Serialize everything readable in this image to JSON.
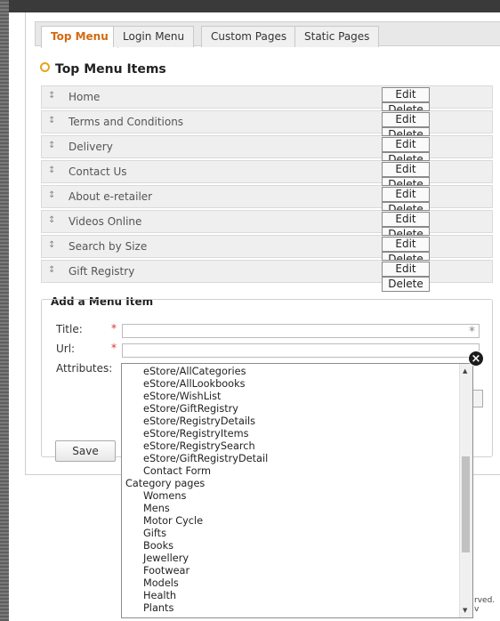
{
  "tabs": [
    {
      "label": "Top Menu",
      "active": true
    },
    {
      "label": "Login Menu",
      "active": false
    },
    {
      "label": "Custom Pages",
      "active": false
    },
    {
      "label": "Static Pages",
      "active": false
    }
  ],
  "section_title": "Top Menu Items",
  "menu_items": [
    {
      "label": "Home"
    },
    {
      "label": "Terms and Conditions"
    },
    {
      "label": "Delivery"
    },
    {
      "label": "Contact Us"
    },
    {
      "label": "About e-retailer"
    },
    {
      "label": "Videos Online"
    },
    {
      "label": "Search by Size"
    },
    {
      "label": "Gift Registry"
    }
  ],
  "row_buttons": {
    "edit": "Edit",
    "delete": "Delete",
    "grip": "↕"
  },
  "add_form": {
    "legend": "Add a Menu Item",
    "title_label": "Title:",
    "url_label": "Url:",
    "attributes_label": "Attributes:",
    "required_mark": "*",
    "save_label": "Save"
  },
  "dropdown_options": [
    {
      "text": "eStore/AllCategories",
      "indent": true
    },
    {
      "text": "eStore/AllLookbooks",
      "indent": true
    },
    {
      "text": "eStore/WishList",
      "indent": true
    },
    {
      "text": "eStore/GiftRegistry",
      "indent": true
    },
    {
      "text": "eStore/RegistryDetails",
      "indent": true
    },
    {
      "text": "eStore/RegistryItems",
      "indent": true
    },
    {
      "text": "eStore/RegistrySearch",
      "indent": true
    },
    {
      "text": "eStore/GiftRegistryDetail",
      "indent": true
    },
    {
      "text": "Contact Form",
      "indent": true
    },
    {
      "text": "Category pages",
      "indent": false
    },
    {
      "text": "Womens",
      "indent": true
    },
    {
      "text": "Mens",
      "indent": true
    },
    {
      "text": "Motor Cycle",
      "indent": true
    },
    {
      "text": "Gifts",
      "indent": true
    },
    {
      "text": "Books",
      "indent": true
    },
    {
      "text": "Jewellery",
      "indent": true
    },
    {
      "text": "Footwear",
      "indent": true
    },
    {
      "text": "Models",
      "indent": true
    },
    {
      "text": "Health",
      "indent": true
    },
    {
      "text": "Plants",
      "indent": true
    }
  ],
  "close_icon": "close-icon",
  "footer_fragment": "rved. v"
}
